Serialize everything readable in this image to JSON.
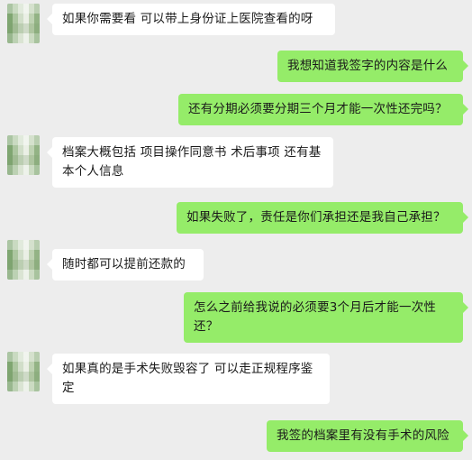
{
  "messages": [
    {
      "side": "in",
      "text": "如果你需要看 可以带上身份证上医院查看的呀"
    },
    {
      "side": "out",
      "text": "我想知道我签字的内容是什么"
    },
    {
      "side": "out",
      "text": "还有分期必须要分期三个月才能一次性还完吗？"
    },
    {
      "side": "in",
      "text": "档案大概包括 项目操作同意书 术后事项 还有基本个人信息"
    },
    {
      "side": "out",
      "text": "如果失败了，责任是你们承担还是我自己承担？"
    },
    {
      "side": "in",
      "text": "随时都可以提前还款的"
    },
    {
      "side": "out",
      "text": "怎么之前给我说的必须要3个月后才能一次性还？"
    },
    {
      "side": "in",
      "text": "如果真的是手术失败毁容了 可以走正规程序鉴定"
    },
    {
      "side": "out",
      "text": "我签的档案里有没有手术的风险"
    }
  ],
  "colors": {
    "background": "#ededed",
    "incoming_bubble": "#ffffff",
    "outgoing_bubble": "#95ec69"
  },
  "avatar_icon": "blurred-avatar"
}
